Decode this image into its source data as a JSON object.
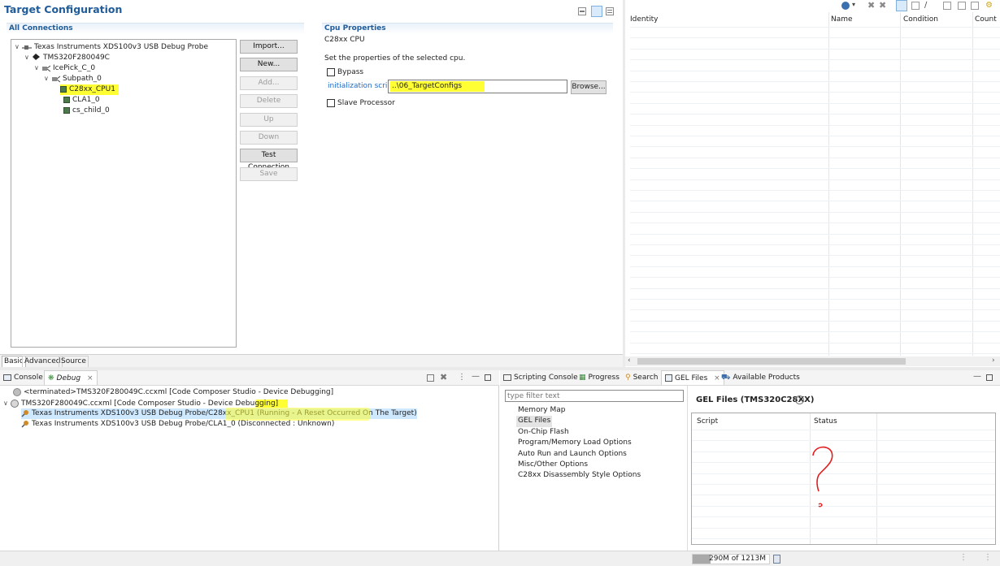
{
  "target_config": {
    "title": "Target Configuration",
    "all_connections_label": "All Connections",
    "tree": [
      {
        "label": "Texas Instruments XDS100v3 USB Debug Probe",
        "icon": "probe-icon"
      },
      {
        "label": "TMS320F280049C",
        "icon": "chip-icon"
      },
      {
        "label": "IcePick_C_0",
        "icon": "router-icon"
      },
      {
        "label": "Subpath_0",
        "icon": "router-icon"
      },
      {
        "label": "C28xx_CPU1",
        "icon": "cpu-icon",
        "highlighted": true
      },
      {
        "label": "CLA1_0",
        "icon": "cpu-icon"
      },
      {
        "label": "cs_child_0",
        "icon": "cpu-icon"
      }
    ],
    "buttons": {
      "import": "Import...",
      "new": "New...",
      "add": "Add...",
      "delete": "Delete",
      "up": "Up",
      "down": "Down",
      "test_connection": "Test Connection",
      "save": "Save"
    },
    "cpu_properties": {
      "header": "Cpu Properties",
      "subtitle": "C28xx CPU",
      "description": "Set the properties of the selected cpu.",
      "bypass_label": "Bypass",
      "init_script_label": "initialization script",
      "init_script_value": "..\\06_TargetConfigs",
      "browse_label": "Browse...",
      "slave_label": "Slave Processor"
    },
    "bottom_tabs": [
      "Basic",
      "Advanced",
      "Source"
    ]
  },
  "right_table": {
    "columns": [
      "Identity",
      "Name",
      "Condition",
      "Count"
    ]
  },
  "debug_panel": {
    "tabs": {
      "console": "Console",
      "debug": "Debug"
    },
    "rows": [
      {
        "text": "<terminated>TMS320F280049C.ccxml [Code Composer Studio - Device Debugging]",
        "icon": "terminated-icon",
        "indent": 0
      },
      {
        "text": "TMS320F280049C.ccxml [Code Composer Studio - Device Debugging]",
        "icon": "debug-session-icon",
        "indent": 0
      },
      {
        "text": "Texas Instruments XDS100v3 USB Debug Probe/C28xx_CPU1 (Running - A Reset Occurred On The Target)",
        "icon": "thread-icon",
        "indent": 1,
        "selected": true
      },
      {
        "text": "Texas Instruments XDS100v3 USB Debug Probe/CLA1_0 (Disconnected : Unknown)",
        "icon": "thread-icon",
        "indent": 1
      }
    ]
  },
  "gel_panel": {
    "tabs": {
      "scripting_console": "Scripting Console",
      "progress": "Progress",
      "search": "Search",
      "gel_files": "GEL Files",
      "available_products": "Available Products"
    },
    "filter_placeholder": "type filter text",
    "nav_items": [
      "Memory Map",
      "GEL Files",
      "On-Chip Flash",
      "Program/Memory Load Options",
      "Auto Run and Launch Options",
      "Misc/Other Options",
      "C28xx Disassembly Style Options"
    ],
    "selected_nav": "GEL Files",
    "title": "GEL Files (TMS320C28XX)",
    "columns": {
      "script": "Script",
      "status": "Status"
    }
  },
  "status_bar": {
    "memory": "290M of 1213M",
    "memory_fraction": 0.239
  },
  "colors": {
    "title_blue": "#1f5c99",
    "link_blue": "#1b6ac9",
    "highlight_yellow": "#ffff33",
    "annotation_red": "#e02020",
    "selection_blue": "#cde8ff"
  }
}
